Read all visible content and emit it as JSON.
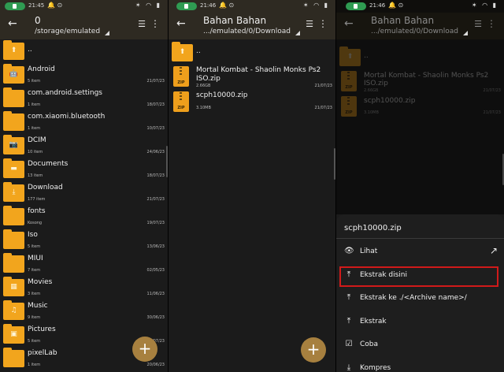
{
  "panel1": {
    "time": "21:45",
    "title": "0",
    "path": "/storage/emulated",
    "items": [
      {
        "name": "..",
        "sub": "",
        "date": "",
        "icon": "up"
      },
      {
        "name": "Android",
        "sub": "5 item",
        "date": "21/07/23",
        "icon": "android"
      },
      {
        "name": "com.android.settings",
        "sub": "1 item",
        "date": "18/07/23",
        "icon": ""
      },
      {
        "name": "com.xiaomi.bluetooth",
        "sub": "1 item",
        "date": "10/07/23",
        "icon": ""
      },
      {
        "name": "DCIM",
        "sub": "10 item",
        "date": "24/06/23",
        "icon": "camera"
      },
      {
        "name": "Documents",
        "sub": "13 item",
        "date": "18/07/23",
        "icon": "doc"
      },
      {
        "name": "Download",
        "sub": "177 item",
        "date": "21/07/23",
        "icon": "download"
      },
      {
        "name": "fonts",
        "sub": "Kosong",
        "date": "19/07/23",
        "icon": ""
      },
      {
        "name": "Iso",
        "sub": "5 item",
        "date": "13/06/23",
        "icon": ""
      },
      {
        "name": "MIUI",
        "sub": "7 item",
        "date": "02/05/23",
        "icon": ""
      },
      {
        "name": "Movies",
        "sub": "3 item",
        "date": "11/06/23",
        "icon": "film"
      },
      {
        "name": "Music",
        "sub": "9 item",
        "date": "30/06/23",
        "icon": "music"
      },
      {
        "name": "Pictures",
        "sub": "5 item",
        "date": "21/07/23",
        "icon": "image"
      },
      {
        "name": "pixelLab",
        "sub": "1 item",
        "date": "20/06/23",
        "icon": ""
      }
    ]
  },
  "panel2": {
    "time": "21:46",
    "title": "Bahan Bahan",
    "path": ".../emulated/0/Download",
    "items": [
      {
        "name": "..",
        "sub": "",
        "date": "",
        "type": "up"
      },
      {
        "name": "Mortal Kombat - Shaolin Monks Ps2\nISO.zip",
        "sub": "2.66GB",
        "date": "21/07/23",
        "type": "zip"
      },
      {
        "name": "scph10000.zip",
        "sub": "3.10MB",
        "date": "21/07/23",
        "type": "zip"
      }
    ]
  },
  "panel3": {
    "time": "21:46",
    "sheet_title": "scph10000.zip",
    "options": [
      {
        "label": "Lihat",
        "icon": "👁"
      },
      {
        "label": "Ekstrak disini",
        "icon": "⤒"
      },
      {
        "label": "Ekstrak ke ./<Archive name>/",
        "icon": "⤒"
      },
      {
        "label": "Ekstrak",
        "icon": "⤒"
      },
      {
        "label": "Coba",
        "icon": "☑"
      },
      {
        "label": "Kompres",
        "icon": "⤓"
      }
    ]
  },
  "fab_label": "+",
  "zip_label": "ZIP",
  "colors": {
    "accent": "#f2a51d",
    "appbar": "#2e2a22",
    "highlight": "#d11a1a",
    "fab": "#a7803f"
  }
}
